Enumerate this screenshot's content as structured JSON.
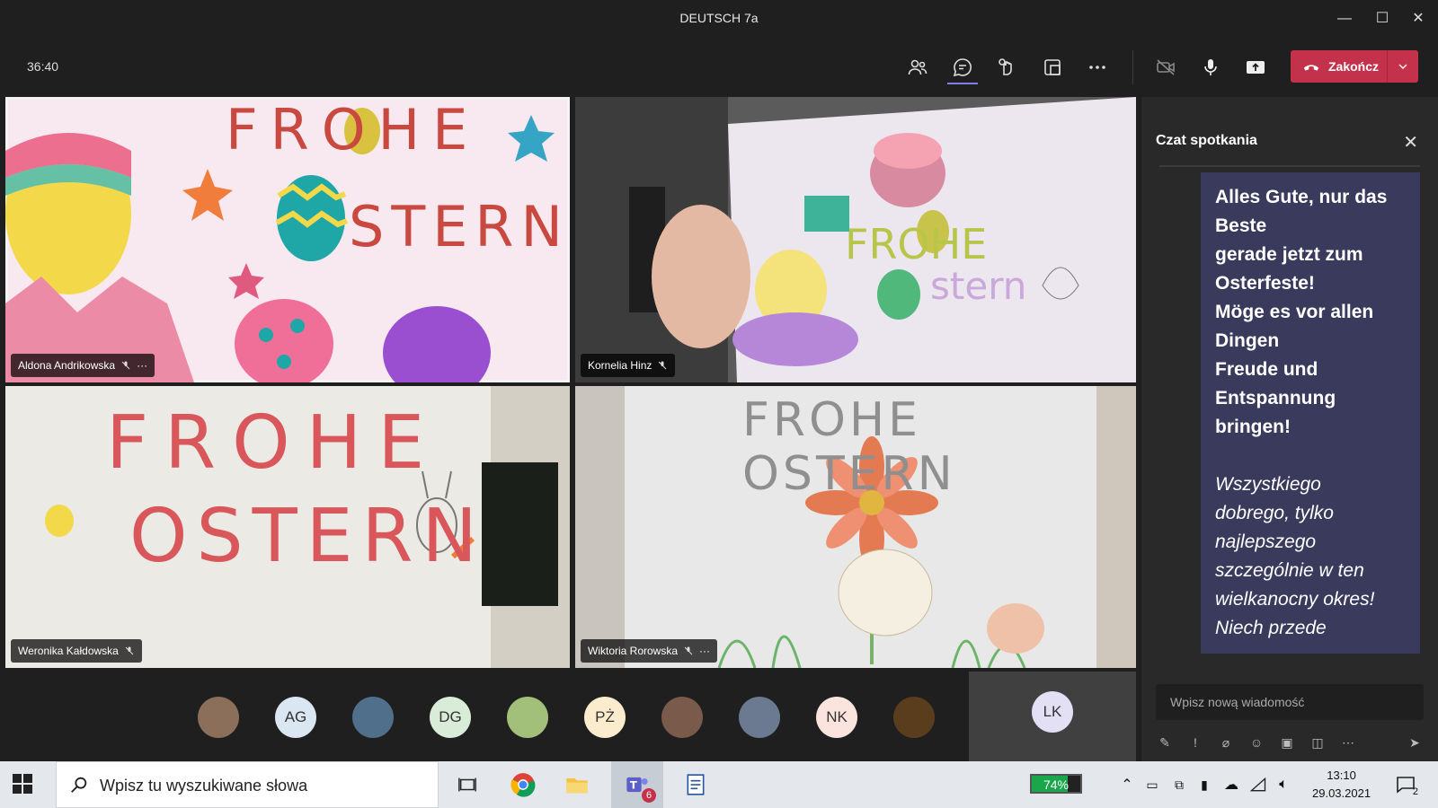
{
  "window": {
    "title": "DEUTSCH 7a",
    "minimize": "—",
    "maximize": "☐",
    "close": "✕"
  },
  "toolbar": {
    "timer": "36:40",
    "end_label": "Zakończ",
    "accent": "#c4314b"
  },
  "tiles": [
    {
      "name": "Aldona Andrikowska",
      "more": "···",
      "active": true,
      "caption_title": "FROHE",
      "caption_sub": "STERN"
    },
    {
      "name": "Kornelia Hinz",
      "more": "",
      "active": false
    },
    {
      "name": "Weronika Kałdowska",
      "more": "",
      "active": false,
      "caption_title": "FROHE",
      "caption_sub": "OSTERN"
    },
    {
      "name": "Wiktoria Rorowska",
      "more": "···",
      "active": false,
      "caption_title": "FROHE OSTERN"
    }
  ],
  "chat": {
    "header": "Czat spotkania",
    "close": "✕",
    "message_de": "Alles Gute, nur das\nBeste\ngerade jetzt zum\nOsterfeste!\nMöge es vor allen\nDingen\nFreude und\nEntspannung\nbringen!",
    "message_pl": "Wszystkiego\ndobrego, tylko\nnajlepszego\nszczególnie w ten\nwielkanocny okres!\nNiech przede",
    "input_placeholder": "Wpisz nową wiadomość",
    "bubble_color": "#393a5c"
  },
  "roster": [
    {
      "initials": "",
      "color": "#8b6f5a"
    },
    {
      "initials": "AG",
      "color": "#dbe6f3"
    },
    {
      "initials": "",
      "color": "#4f6f8a"
    },
    {
      "initials": "DG",
      "color": "#d8ecd8"
    },
    {
      "initials": "",
      "color": "#a2c07a"
    },
    {
      "initials": "PŻ",
      "color": "#fbeccd"
    },
    {
      "initials": "",
      "color": "#7a5a4a"
    },
    {
      "initials": "",
      "color": "#6b7a90"
    },
    {
      "initials": "NK",
      "color": "#fbe3de"
    },
    {
      "initials": "",
      "color": "#5a3d1d"
    }
  ],
  "roster_active": {
    "initials": "LK",
    "color": "#e3dff4"
  },
  "taskbar": {
    "search_text": "Wpisz tu wyszukiwane słowa",
    "battery_pct": "74%",
    "battery_level": 0.74,
    "time": "13:10",
    "date": "29.03.2021",
    "teams_badge": "6",
    "notif_count": "2"
  }
}
